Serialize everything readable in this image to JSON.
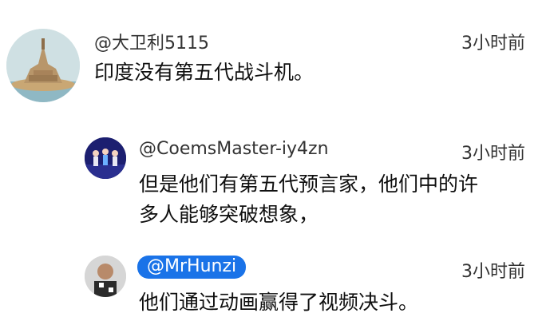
{
  "comments": [
    {
      "author": "@大卫利5115",
      "time": "3小时前",
      "text": "印度没有第五代战斗机。",
      "avatar_icon": "castle-island-avatar"
    },
    {
      "author": "@CoemsMaster-iy4zn",
      "time": "3小时前",
      "text_line1": "但是他们有第五代预言家，他们中的许",
      "text_line2": "多人能够突破想象，",
      "avatar_icon": "dancers-avatar"
    },
    {
      "author": "@MrHunzi",
      "time": "3小时前",
      "text": "他们通过动画赢得了视频决斗。",
      "avatar_icon": "person-avatar",
      "author_chip_color": "#1a73e8"
    }
  ]
}
